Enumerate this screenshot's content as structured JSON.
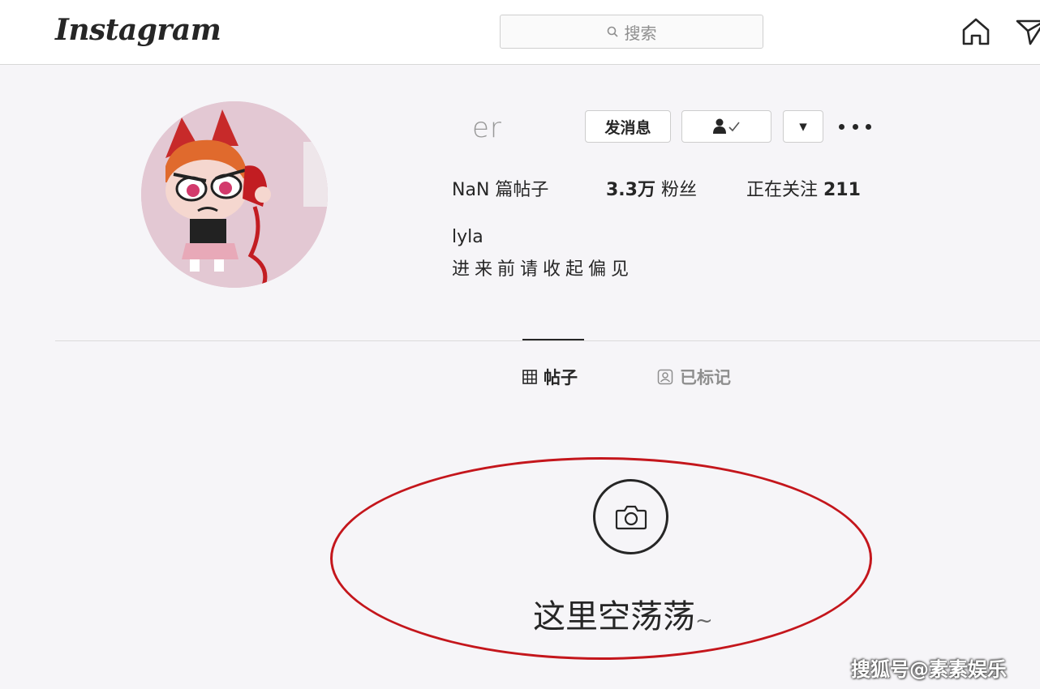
{
  "header": {
    "logo": "Instagram",
    "search_placeholder": "搜索"
  },
  "profile": {
    "username": "er",
    "buttons": {
      "message": "发消息",
      "dropdown": "▾"
    },
    "stats": {
      "posts_value": "NaN",
      "posts_label": " 篇帖子",
      "followers_value": "3.3万",
      "followers_label": " 粉丝",
      "following_label": "正在关注 ",
      "following_value": "211"
    },
    "full_name": "lyla",
    "bio": "进来前请收起偏见"
  },
  "tabs": {
    "posts": "帖子",
    "tagged": "已标记"
  },
  "empty_state": {
    "text": "这里空荡荡",
    "tilde": "~"
  },
  "watermark": "搜狐号@素素娱乐",
  "colors": {
    "highlight_ellipse": "#c4161c",
    "background": "#f6f5f8",
    "avatar_bg": "#e3c8d3"
  },
  "icons": [
    "search-icon",
    "home-icon",
    "direct-icon",
    "follow-check-icon",
    "grid-icon",
    "tagged-icon",
    "camera-icon"
  ]
}
